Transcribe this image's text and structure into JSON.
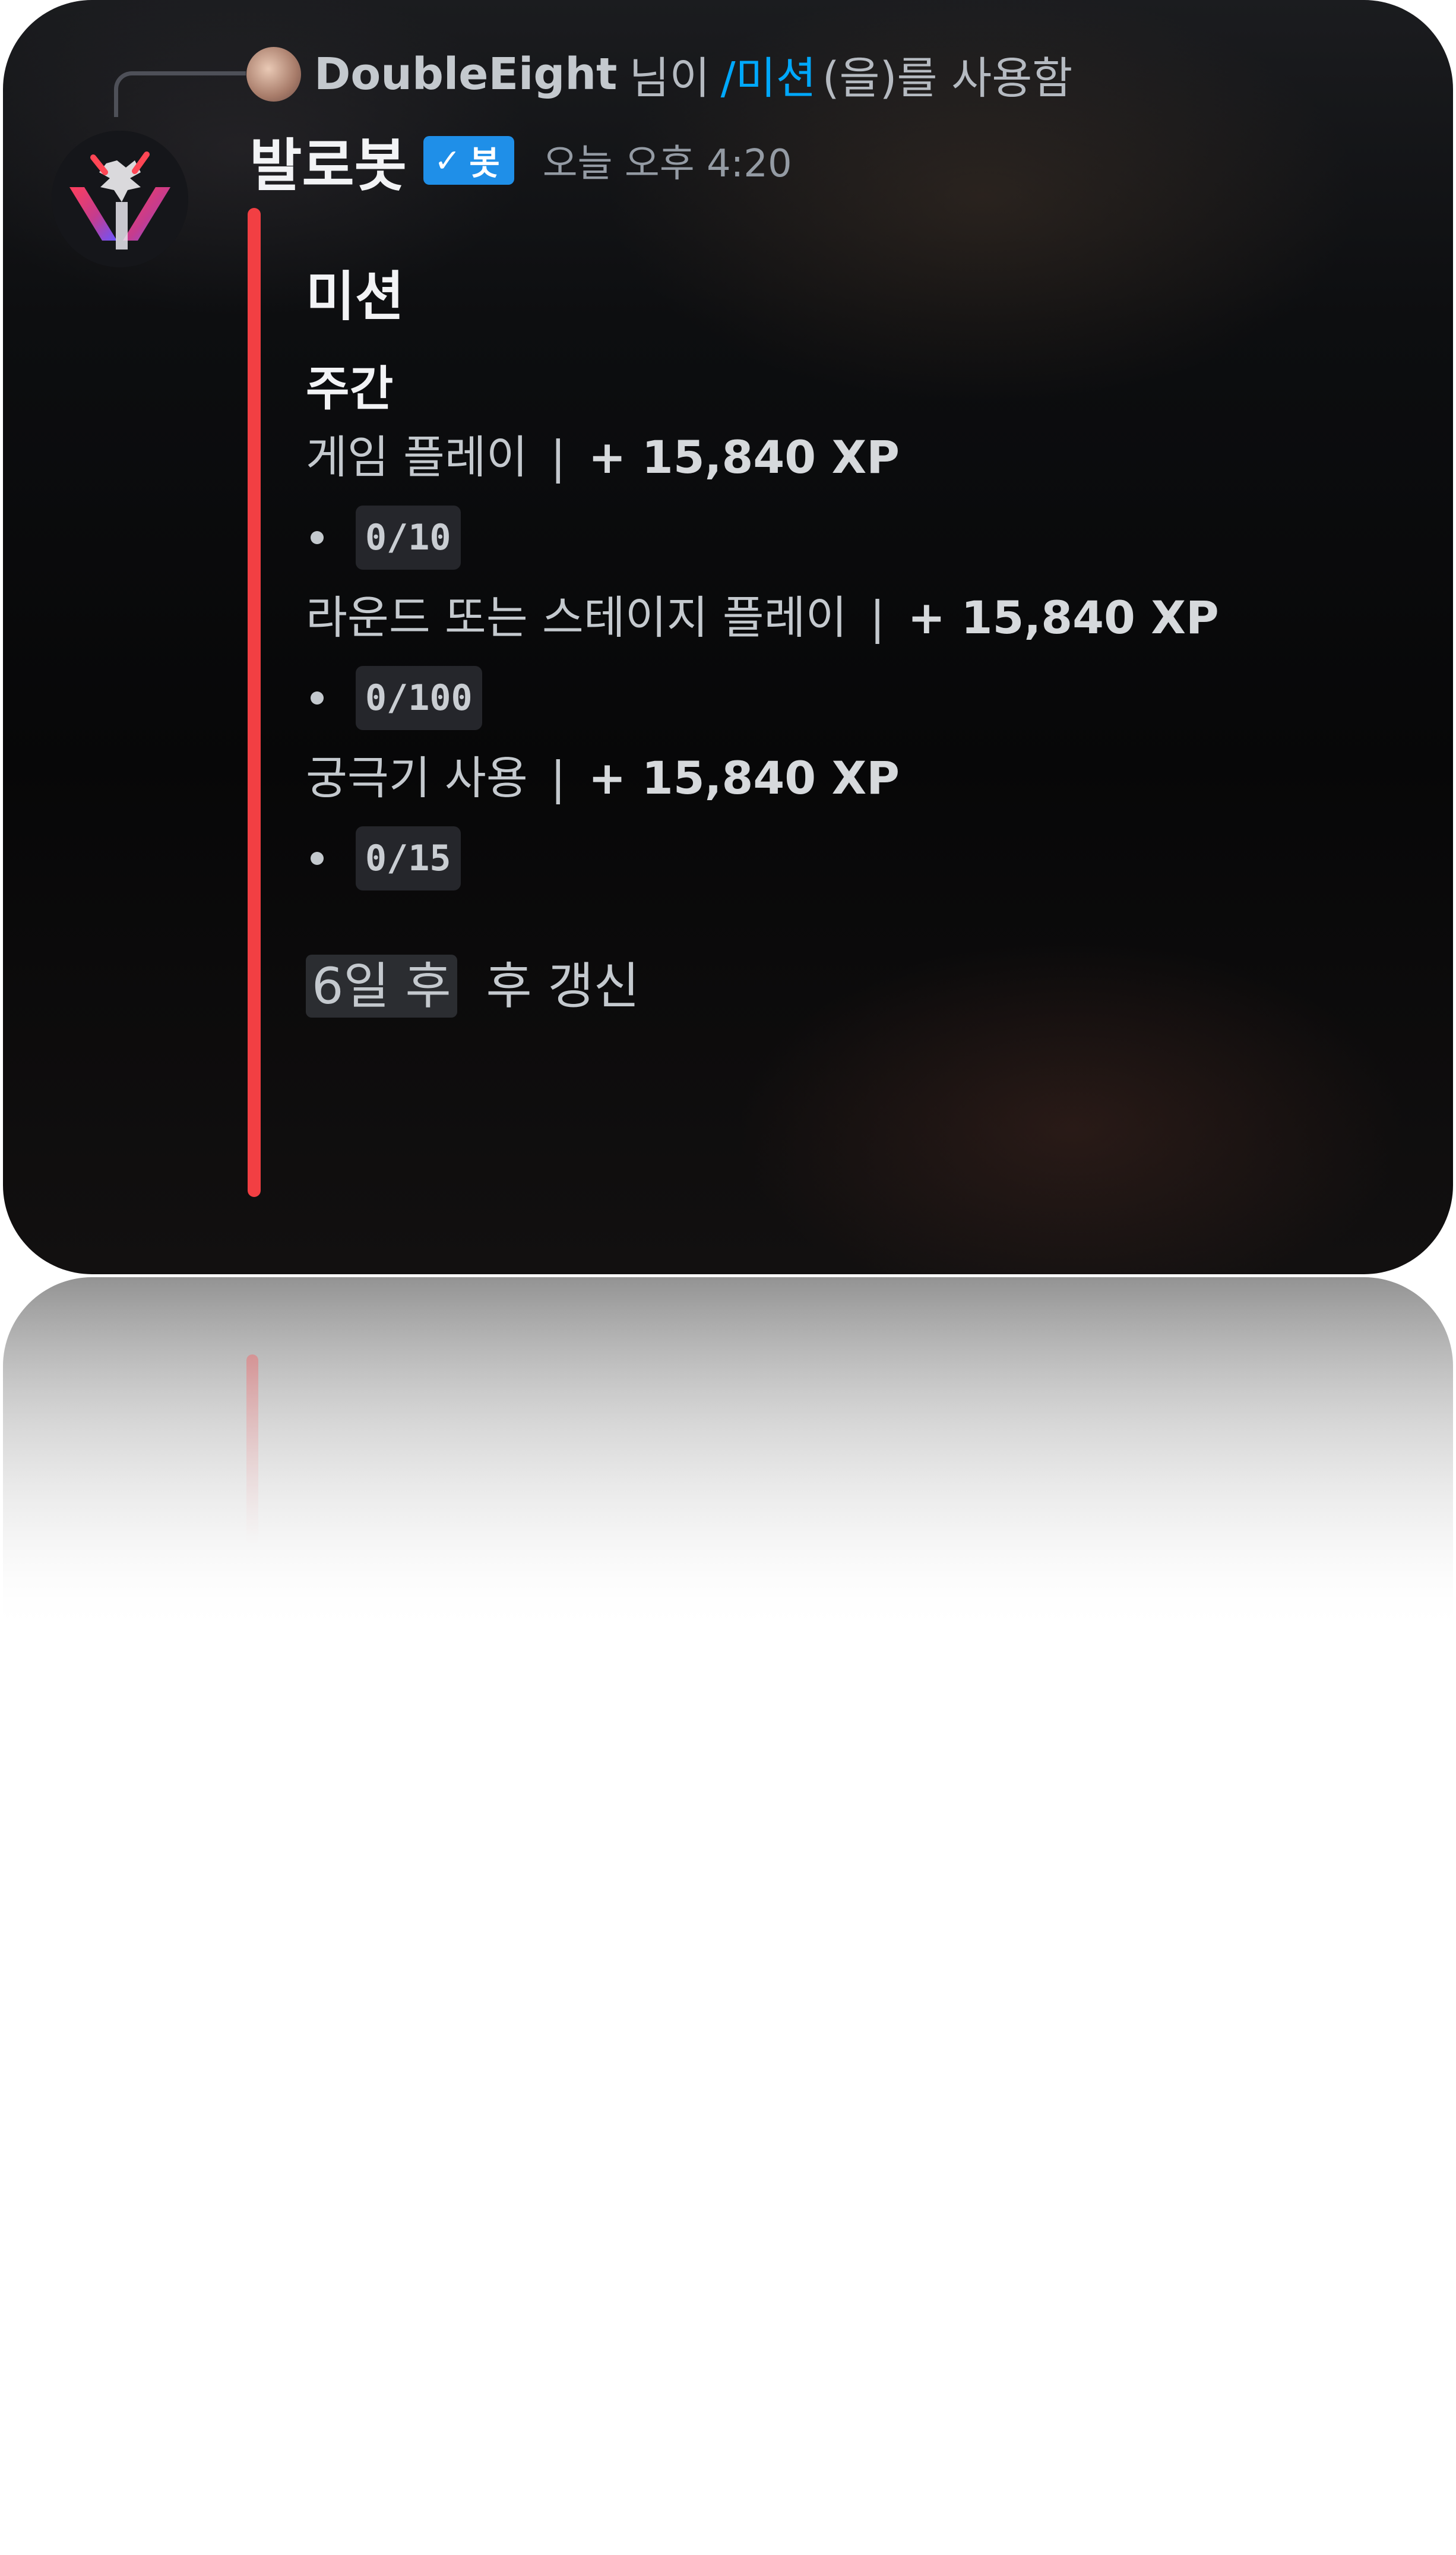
{
  "reply": {
    "username": "DoubleEight",
    "text_before": "님이",
    "command": "/미션",
    "text_after": "(을)를 사용함"
  },
  "message": {
    "author": "발로봇",
    "bot_tag": "봇",
    "timestamp": "오늘 오후 4:20"
  },
  "embed": {
    "accent_color": "#f23f43",
    "title": "미션",
    "section": "주간",
    "missions": [
      {
        "name": "게임 플레이",
        "separator": "|",
        "reward": "+ 15,840 XP",
        "progress": "0/10"
      },
      {
        "name": "라운드 또는 스테이지 플레이",
        "separator": "|",
        "reward": "+ 15,840 XP",
        "progress": "0/100"
      },
      {
        "name": "궁극기 사용",
        "separator": "|",
        "reward": "+ 15,840 XP",
        "progress": "0/15"
      }
    ],
    "footer": {
      "relative_time": "6일 후",
      "suffix": "후 갱신"
    }
  },
  "icons": {
    "check": "check-icon",
    "bullet": "bullet-icon"
  }
}
